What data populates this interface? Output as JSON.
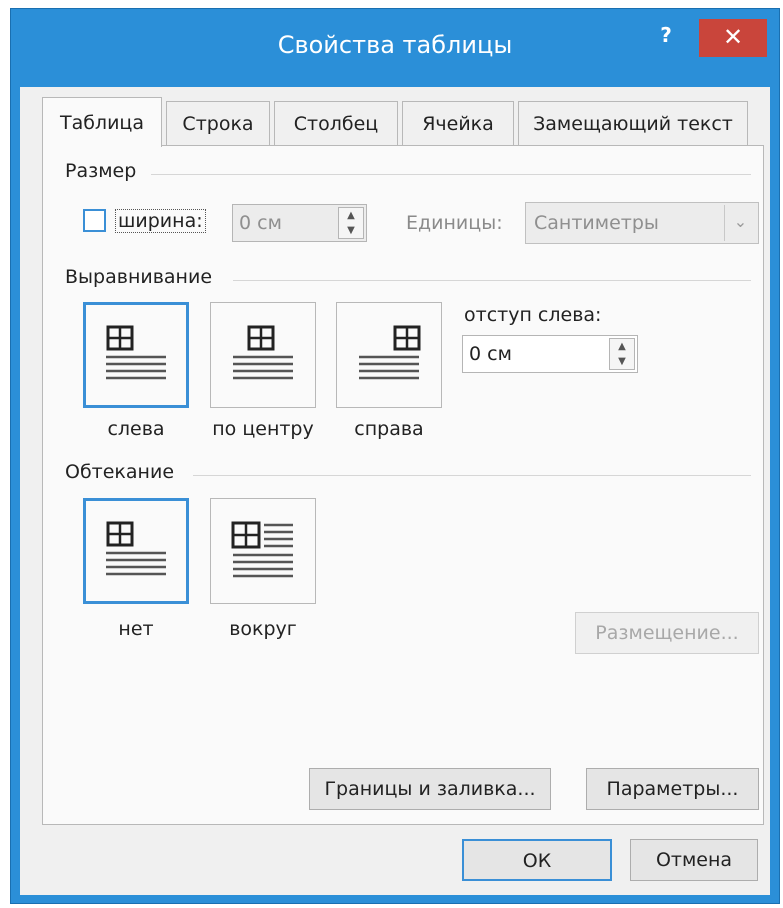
{
  "window": {
    "title": "Свойства таблицы",
    "help_label": "?",
    "close_label": "✕"
  },
  "tabs": [
    {
      "label": "Таблица",
      "active": true
    },
    {
      "label": "Строка",
      "active": false
    },
    {
      "label": "Столбец",
      "active": false
    },
    {
      "label": "Ячейка",
      "active": false
    },
    {
      "label": "Замещающий текст",
      "active": false
    }
  ],
  "size": {
    "section_label": "Размер",
    "width_checkbox_label": "ширина:",
    "width_checked": false,
    "width_value": "0 см",
    "units_label": "Единицы:",
    "units_value": "Сантиметры"
  },
  "alignment": {
    "section_label": "Выравнивание",
    "options": [
      {
        "label": "слева",
        "selected": true,
        "icon": "align-left-icon"
      },
      {
        "label": "по центру",
        "selected": false,
        "icon": "align-center-icon"
      },
      {
        "label": "справа",
        "selected": false,
        "icon": "align-right-icon"
      }
    ],
    "indent_label": "отступ слева:",
    "indent_value": "0 см"
  },
  "wrapping": {
    "section_label": "Обтекание",
    "options": [
      {
        "label": "нет",
        "selected": true,
        "icon": "wrap-none-icon"
      },
      {
        "label": "вокруг",
        "selected": false,
        "icon": "wrap-around-icon"
      }
    ],
    "positioning_label": "Размещение..."
  },
  "buttons": {
    "borders_label": "Границы и заливка...",
    "options_label": "Параметры...",
    "ok_label": "ОК",
    "cancel_label": "Отмена"
  },
  "colors": {
    "titlebar": "#2b8fd8",
    "close": "#c9453b",
    "selection": "#3a8fd6"
  }
}
